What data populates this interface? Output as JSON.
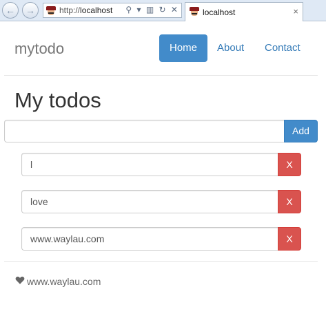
{
  "browser": {
    "address": {
      "protocol": "http://",
      "host": "localhost"
    },
    "address_icons": "⚲ ▾ ▥ ↻ ✕",
    "tab": {
      "title": "localhost",
      "close": "×"
    },
    "back_glyph": "←",
    "forward_glyph": "→"
  },
  "navbar": {
    "brand": "mytodo",
    "links": [
      {
        "label": "Home",
        "active": true
      },
      {
        "label": "About",
        "active": false
      },
      {
        "label": "Contact",
        "active": false
      }
    ]
  },
  "main": {
    "title": "My todos",
    "new_todo": {
      "value": "",
      "button_label": "Add"
    },
    "todos": [
      {
        "text": "l",
        "delete_label": "X"
      },
      {
        "text": "love",
        "delete_label": "X"
      },
      {
        "text": "www.waylau.com",
        "delete_label": "X"
      }
    ]
  },
  "footer": {
    "icon": "heart-icon",
    "text": "www.waylau.com"
  },
  "colors": {
    "primary": "#428bca",
    "danger": "#d9534f",
    "link": "#337ab7"
  }
}
